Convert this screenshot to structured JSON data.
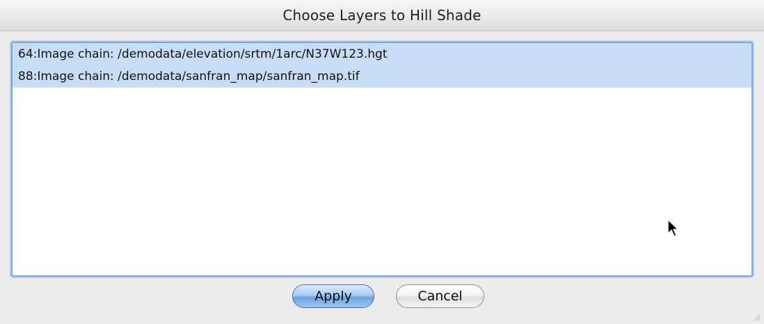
{
  "window": {
    "title": "Choose Layers to Hill Shade"
  },
  "layers": {
    "items": [
      {
        "label": "64:Image chain: /demodata/elevation/srtm/1arc/N37W123.hgt",
        "selected": true
      },
      {
        "label": "88:Image chain: /demodata/sanfran_map/sanfran_map.tif",
        "selected": true
      }
    ]
  },
  "buttons": {
    "apply_label": "Apply",
    "cancel_label": "Cancel"
  },
  "icons": {
    "cursor": "arrow-cursor-icon",
    "resize": "resize-grip-icon"
  },
  "colors": {
    "selection": "#c7dcf5",
    "focus_ring": "#7fa6d1",
    "default_button": "#6ea3df"
  }
}
